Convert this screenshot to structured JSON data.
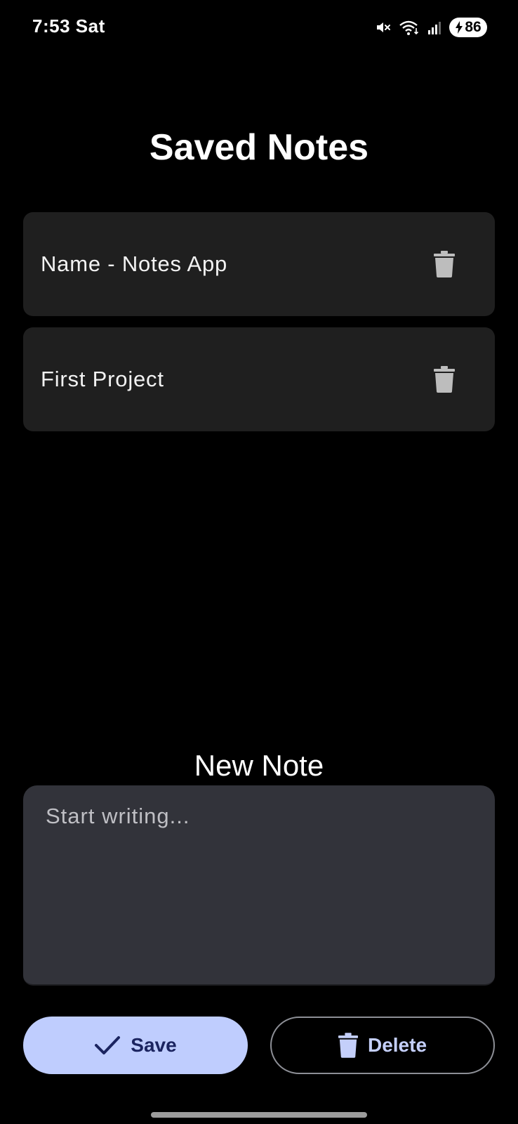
{
  "status_bar": {
    "time": "7:53  Sat",
    "battery": "86",
    "icons": [
      "mute-icon",
      "wifi-icon",
      "signal-icon",
      "battery-charging-icon"
    ]
  },
  "page_title": "Saved Notes",
  "notes": [
    {
      "title": "Name - Notes App",
      "delete_icon": "trash-icon"
    },
    {
      "title": "First Project",
      "delete_icon": "trash-icon"
    }
  ],
  "new_note": {
    "label": "New Note",
    "placeholder": "Start writing...",
    "value": ""
  },
  "actions": {
    "save_label": "Save",
    "save_icon": "check-icon",
    "delete_label": "Delete",
    "delete_icon": "trash-icon"
  },
  "colors": {
    "background": "#000000",
    "card": "#1f1f1f",
    "input": "#32333a",
    "save_button": "#bfcdfe",
    "save_text": "#1b2460",
    "delete_text": "#c4cffa"
  }
}
